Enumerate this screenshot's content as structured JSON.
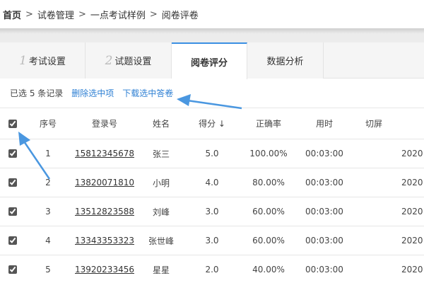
{
  "breadcrumb": {
    "home": "首页",
    "items": [
      "试卷管理",
      "一点考试样例",
      "阅卷评卷"
    ],
    "separator": ">"
  },
  "tabs": [
    {
      "num": "1",
      "label": "考试设置",
      "active": false
    },
    {
      "num": "2",
      "label": "试题设置",
      "active": false
    },
    {
      "num": "",
      "label": "阅卷评分",
      "active": true
    },
    {
      "num": "",
      "label": "数据分析",
      "active": false
    }
  ],
  "actions": {
    "selected_text": "已选 5 条记录",
    "delete_label": "删除选中项",
    "download_label": "下载选中答卷"
  },
  "table": {
    "headers": {
      "no": "序号",
      "login": "登录号",
      "name": "姓名",
      "score": "得分 ↓",
      "rate": "正确率",
      "time": "用时",
      "cut": "切屏"
    },
    "rows": [
      {
        "no": "1",
        "login": "15812345678",
        "name": "张三",
        "score": "5.0",
        "rate": "100.00%",
        "time": "00:03:00",
        "date": "2020"
      },
      {
        "no": "2",
        "login": "13820071810",
        "name": "小明",
        "score": "4.0",
        "rate": "80.00%",
        "time": "00:03:00",
        "date": "2020"
      },
      {
        "no": "3",
        "login": "13512823588",
        "name": "刘峰",
        "score": "3.0",
        "rate": "60.00%",
        "time": "00:03:00",
        "date": "2020"
      },
      {
        "no": "4",
        "login": "13343353323",
        "name": "张世峰",
        "score": "3.0",
        "rate": "60.00%",
        "time": "00:03:00",
        "date": "2020"
      },
      {
        "no": "5",
        "login": "13920233456",
        "name": "星星",
        "score": "2.0",
        "rate": "40.00%",
        "time": "00:03:00",
        "date": "2020"
      }
    ]
  },
  "colors": {
    "accent": "#3b8fe3",
    "link": "#2d7fd3",
    "annotation_arrow": "#4a97e0"
  }
}
